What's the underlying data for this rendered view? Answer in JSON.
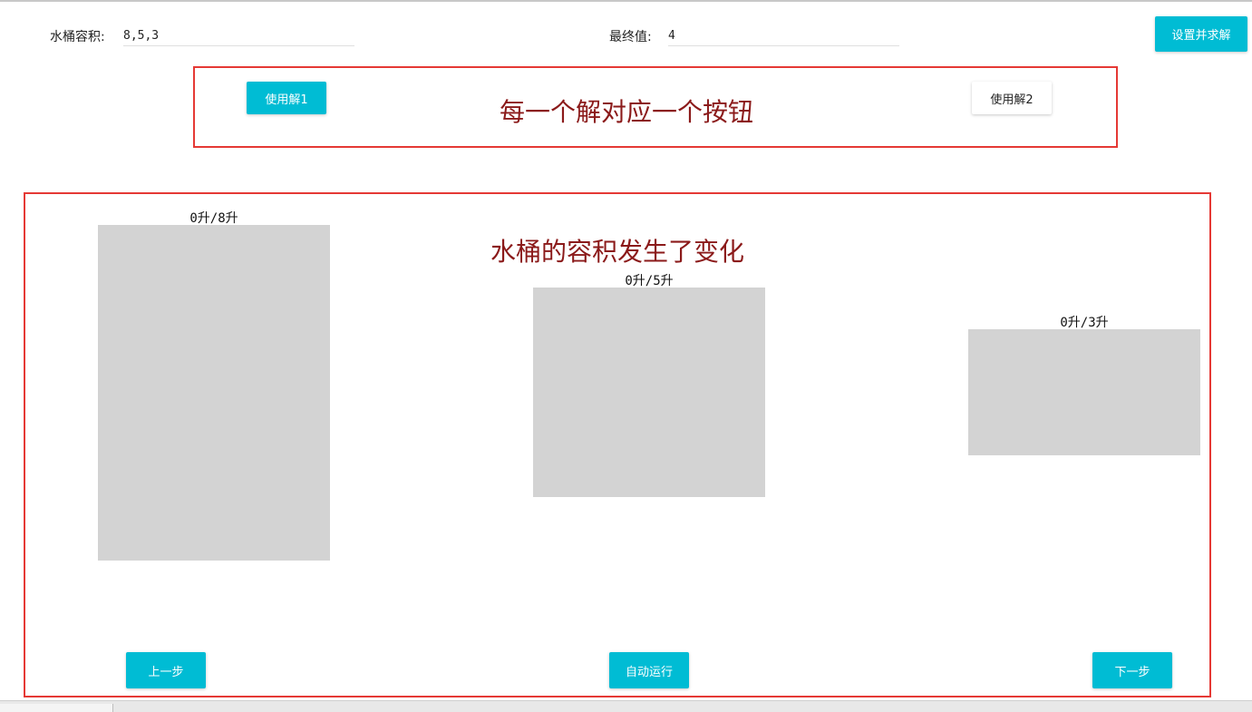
{
  "form": {
    "capacity_label": "水桶容积:",
    "capacity_value": "8,5,3",
    "final_label": "最终值:",
    "final_value": "4",
    "submit_label": "设置并求解"
  },
  "solutions": {
    "buttons": [
      "使用解1",
      "使用解2"
    ],
    "annotation": "每一个解对应一个按钮"
  },
  "stage": {
    "annotation": "水桶的容积发生了变化",
    "buckets": [
      {
        "label": "0升/8升",
        "current": 0,
        "capacity": 8
      },
      {
        "label": "0升/5升",
        "current": 0,
        "capacity": 5
      },
      {
        "label": "0升/3升",
        "current": 0,
        "capacity": 3
      }
    ]
  },
  "controls": {
    "prev_label": "上一步",
    "auto_label": "自动运行",
    "next_label": "下一步"
  },
  "colors": {
    "accent": "#00bcd4",
    "annotation_border": "#e53935",
    "annotation_text": "#8b1a1a",
    "bucket_fill": "#d3d3d3"
  }
}
